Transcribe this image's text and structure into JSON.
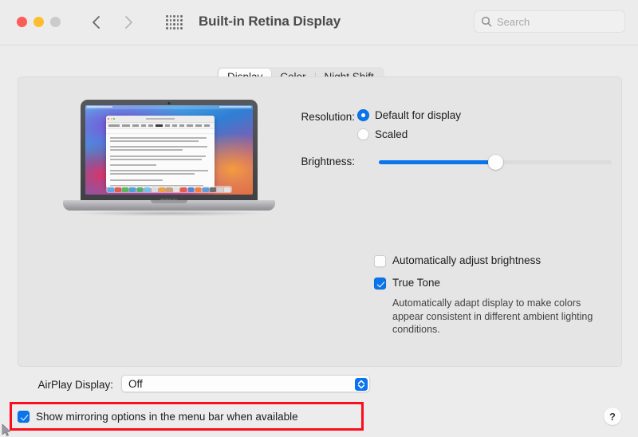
{
  "window": {
    "title": "Built-in Retina Display",
    "traffic_lights": [
      "close",
      "minimize",
      "zoom"
    ],
    "back_label": "Back",
    "forward_label": "Forward",
    "grid_label": "Show All"
  },
  "search": {
    "placeholder": "Search",
    "value": ""
  },
  "tabs": [
    {
      "label": "Display",
      "active": true
    },
    {
      "label": "Color",
      "active": false
    },
    {
      "label": "Night Shift",
      "active": false
    }
  ],
  "display": {
    "resolution_label": "Resolution:",
    "resolution_options": [
      {
        "label": "Default for display",
        "selected": true
      },
      {
        "label": "Scaled",
        "selected": false
      }
    ],
    "brightness_label": "Brightness:",
    "brightness_percent": 50,
    "auto_brightness": {
      "label": "Automatically adjust brightness",
      "checked": false
    },
    "true_tone": {
      "label": "True Tone",
      "checked": true,
      "description": "Automatically adapt display to make colors appear consistent in different ambient lighting conditions."
    }
  },
  "airplay": {
    "label": "AirPlay Display:",
    "value": "Off",
    "options": [
      "Off"
    ]
  },
  "mirroring": {
    "label": "Show mirroring options in the menu bar when available",
    "checked": true,
    "highlight_color": "#fc0d1b"
  },
  "help": {
    "label": "?"
  },
  "colors": {
    "accent": "#0a74ed",
    "window_bg": "#ececec",
    "panel_bg": "#e5e5e5",
    "close": "#fc5d57",
    "minimize": "#fdbd2e",
    "zoom": "#cbcbcb"
  },
  "preview": {
    "device_label": "MacBook Pro",
    "dock_colors": [
      "#5aa9e6",
      "#e05a4e",
      "#58b85c",
      "#4ba3d8",
      "#47b76d",
      "#6fc3e8",
      "#d8dde2",
      "#f0a23a",
      "#c9a07a",
      "#e8e2d6",
      "#e85a4f",
      "#4f86d8",
      "#f0813a",
      "#5a9de0",
      "#6d6f72",
      "#cfd2d6",
      "#e2e5e8"
    ]
  }
}
